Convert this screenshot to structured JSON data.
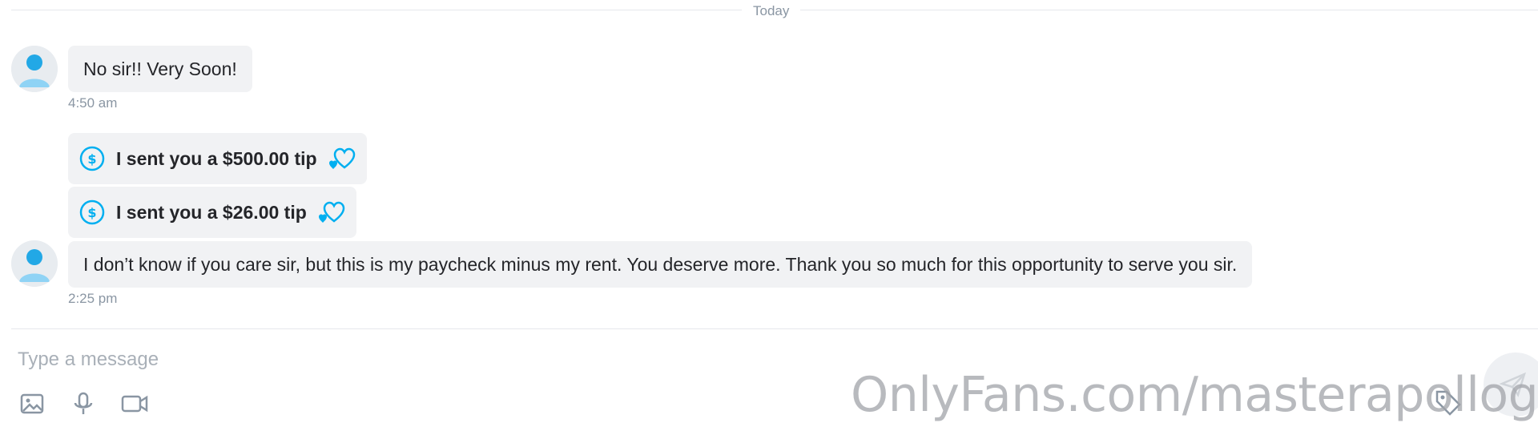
{
  "divider": {
    "label": "Today"
  },
  "messages": [
    {
      "type": "text",
      "text": "No sir!! Very Soon!",
      "time": "4:50 am"
    },
    {
      "type": "tip",
      "text": "I sent you a $500.00 tip"
    },
    {
      "type": "tip",
      "text": "I sent you a $26.00 tip"
    },
    {
      "type": "text",
      "text": "I don’t know if you care sir, but this is my paycheck minus my rent. You deserve more. Thank you so much for this opportunity to serve you sir.",
      "time": "2:25 pm"
    }
  ],
  "composer": {
    "placeholder": "Type a message",
    "value": ""
  },
  "icons": {
    "avatar": "default-user-avatar",
    "tip": "dollar-circle-icon",
    "tip_reaction": "hearts-icon",
    "tools": [
      "image-icon",
      "microphone-icon",
      "video-camera-icon"
    ],
    "price": "price-tag-icon",
    "send": "send-plane-icon"
  },
  "colors": {
    "accent": "#00aff0",
    "bubble": "#f1f2f4",
    "muted": "#8a96a3"
  },
  "watermark": "OnlyFans.com/masterapollogod"
}
